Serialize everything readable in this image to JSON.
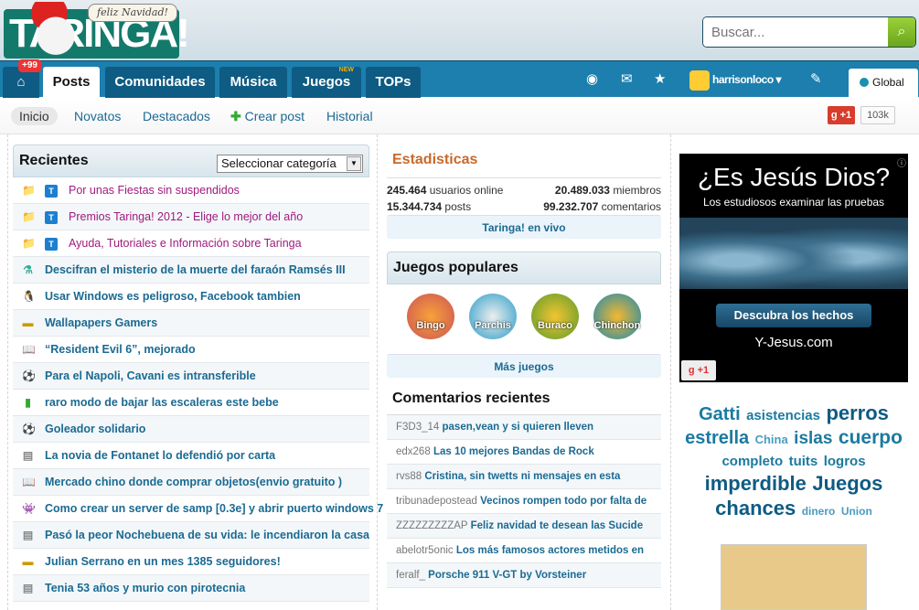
{
  "header": {
    "logo_text": "TARINGA!",
    "bubble": "feliz Navidad!",
    "search_placeholder": "Buscar..."
  },
  "nav": {
    "badge": "+99",
    "tabs": [
      "Posts",
      "Comunidades",
      "Música",
      "Juegos",
      "TOPs"
    ],
    "new_label": "NEW",
    "username": "harrisonloco",
    "global": "Global"
  },
  "subnav": {
    "items": [
      "Inicio",
      "Novatos",
      "Destacados",
      "Crear post",
      "Historial"
    ],
    "gplus": "+1",
    "gplus_count": "103k"
  },
  "recientes": {
    "title": "Recientes",
    "category_select": "Seleccionar categoría",
    "items": [
      {
        "icon": "sticky",
        "label": "Por unas Fiestas sin suspendidos"
      },
      {
        "icon": "sticky",
        "label": "Premios Taringa! 2012 - Elige lo mejor del año"
      },
      {
        "icon": "sticky",
        "label": "Ayuda, Tutoriales e Información sobre Taringa"
      },
      {
        "icon": "science",
        "label": "Descifran el misterio de la muerte del faraón Ramsés III"
      },
      {
        "icon": "linux",
        "label": "Usar Windows es peligroso, Facebook tambien"
      },
      {
        "icon": "image",
        "label": "Wallapapers Gamers"
      },
      {
        "icon": "book",
        "label": "“Resident Evil 6”, mejorado"
      },
      {
        "icon": "soccer",
        "label": "Para el Napoli, Cavani es intransferible"
      },
      {
        "icon": "film",
        "label": "raro modo de bajar las escaleras este bebe"
      },
      {
        "icon": "soccer",
        "label": "Goleador solidario"
      },
      {
        "icon": "news",
        "label": "La novia de Fontanet lo defendió por carta"
      },
      {
        "icon": "book",
        "label": "Mercado chino donde comprar objetos(envio gratuito )"
      },
      {
        "icon": "games",
        "label": "Como crear un server de samp [0.3e] y abrir puerto windows 7"
      },
      {
        "icon": "news",
        "label": "Pasó la peor Nochebuena de su vida: le incendiaron la casa"
      },
      {
        "icon": "image",
        "label": "Julian Serrano en un mes 1385 seguidores!"
      },
      {
        "icon": "news",
        "label": "Tenia 53 años y murio con pirotecnia"
      }
    ]
  },
  "stats": {
    "title": "Estadisticas",
    "online_num": "245.464",
    "online_label": "usuarios online",
    "members_num": "20.489.033",
    "members_label": "miembros",
    "posts_num": "15.344.734",
    "posts_label": "posts",
    "comments_num": "99.232.707",
    "comments_label": "comentarios",
    "live": "Taringa! en vivo"
  },
  "juegos": {
    "title": "Juegos populares",
    "games": [
      "Bingo",
      "Parchis",
      "Buraco",
      "Chinchon"
    ],
    "more": "Más juegos"
  },
  "comentarios": {
    "title": "Comentarios recientes",
    "items": [
      {
        "user": "F3D3_14",
        "post": "pasen,vean y si quieren lleven"
      },
      {
        "user": "edx268",
        "post": "Las 10 mejores Bandas de Rock"
      },
      {
        "user": "rvs88",
        "post": "Cristina, sin twetts ni mensajes en esta"
      },
      {
        "user": "tribunadepostead",
        "post": "Vecinos rompen todo por falta de"
      },
      {
        "user": "ZZZZZZZZZAP",
        "post": "Feliz navidad te desean las Sucide"
      },
      {
        "user": "abelotr5onic",
        "post": "Los más famosos actores metidos en"
      },
      {
        "user": "feralf_",
        "post": "Porsche 911 V-GT by Vorsteiner"
      }
    ]
  },
  "ad": {
    "title": "¿Es Jesús Dios?",
    "subtitle": "Los estudiosos examinar las pruebas",
    "button": "Descubra los hechos",
    "url": "Y-Jesus.com",
    "gplus": "+1"
  },
  "tags": [
    {
      "t": "Gatti",
      "s": 20
    },
    {
      "t": "asistencias",
      "s": 15
    },
    {
      "t": "perros",
      "s": 22
    },
    {
      "t": "estrella",
      "s": 20
    },
    {
      "t": "China",
      "s": 13
    },
    {
      "t": "islas",
      "s": 19
    },
    {
      "t": "cuerpo",
      "s": 21
    },
    {
      "t": "completo",
      "s": 15
    },
    {
      "t": "tuits",
      "s": 15
    },
    {
      "t": "logros",
      "s": 15
    },
    {
      "t": "imperdible",
      "s": 22
    },
    {
      "t": "Juegos",
      "s": 22
    },
    {
      "t": "chances",
      "s": 22
    },
    {
      "t": "dinero",
      "s": 12
    },
    {
      "t": "Union",
      "s": 12
    }
  ]
}
